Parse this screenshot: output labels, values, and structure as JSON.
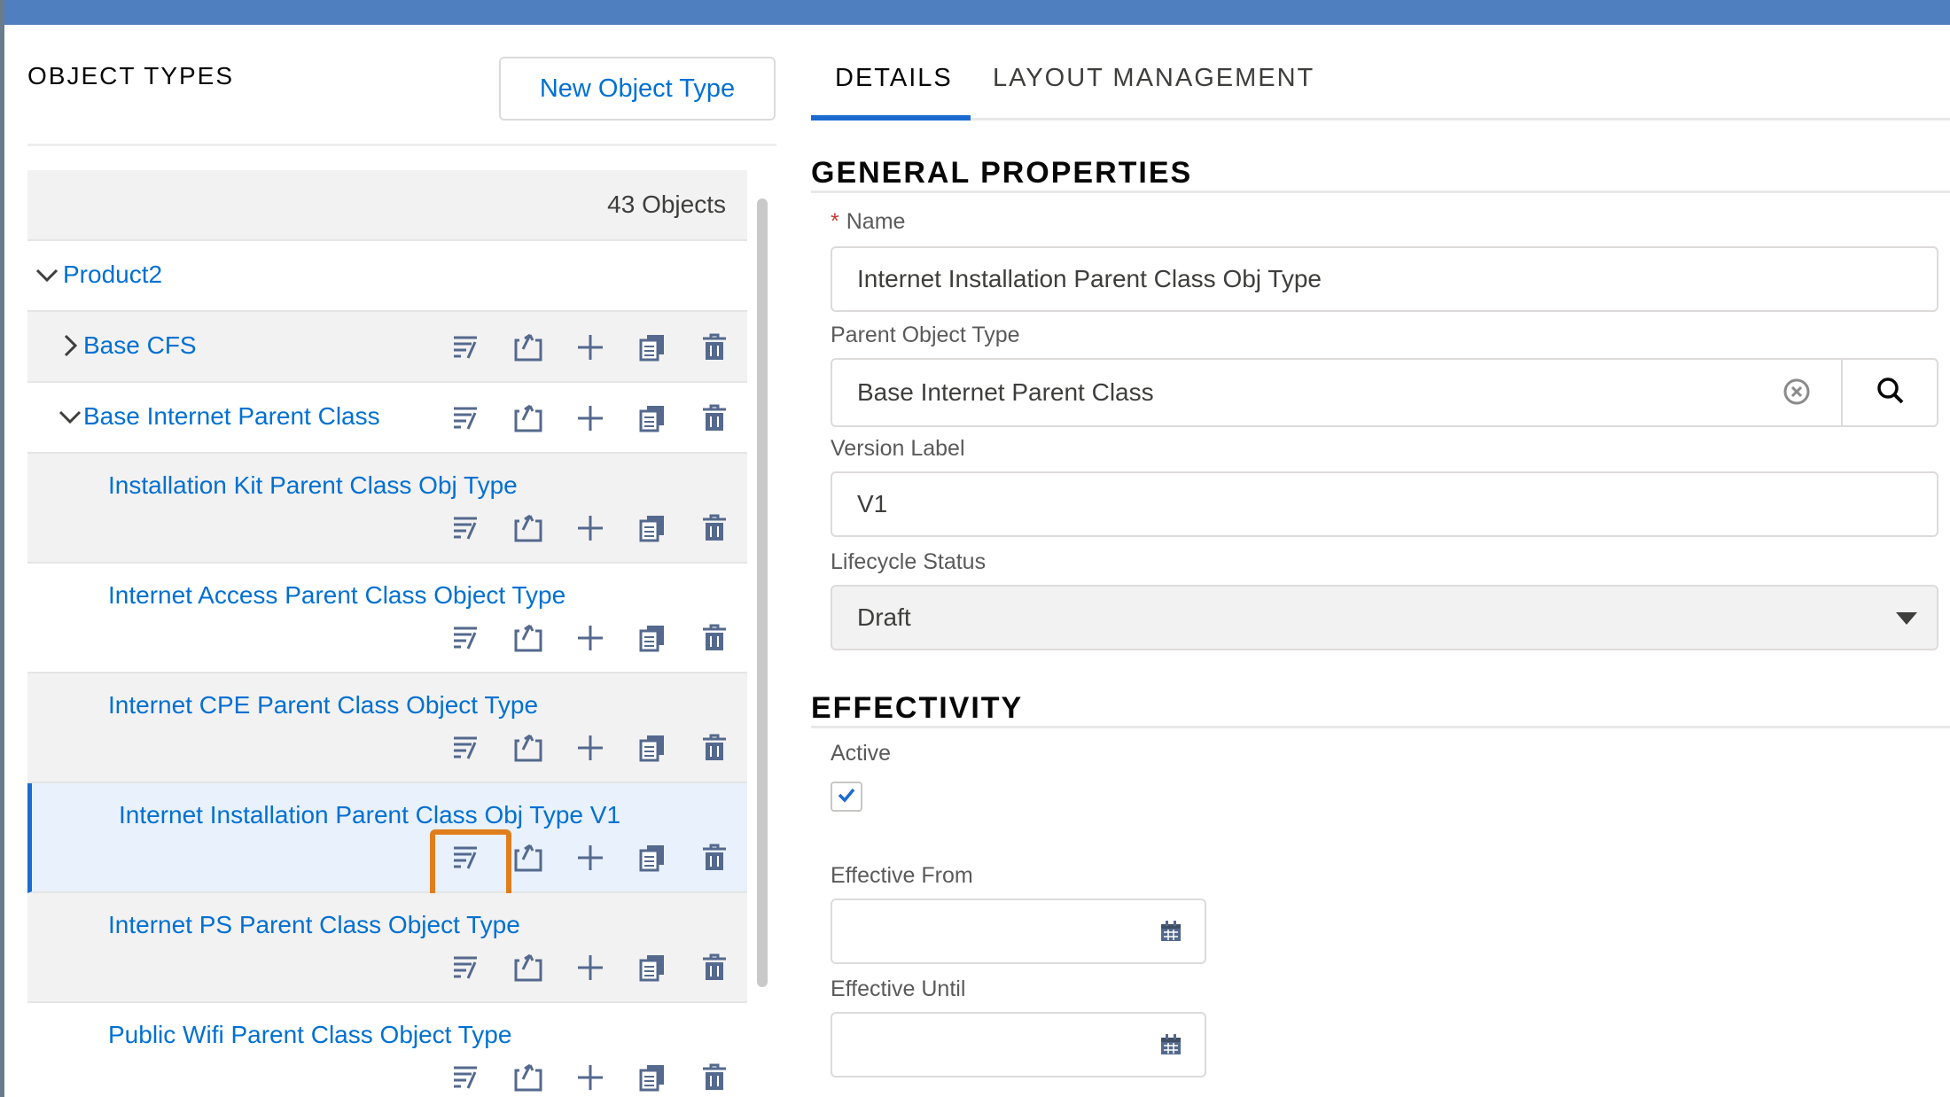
{
  "left": {
    "title": "OBJECT TYPES",
    "new_button": "New Object Type",
    "count": "43 Objects",
    "items": [
      {
        "label": "Product2"
      },
      {
        "label": "Base CFS"
      },
      {
        "label": "Base Internet Parent Class"
      },
      {
        "label": "Installation Kit Parent Class Obj Type"
      },
      {
        "label": "Internet Access Parent Class Object Type"
      },
      {
        "label": "Internet CPE Parent Class Object Type"
      },
      {
        "label": "Internet Installation Parent Class Obj Type V1"
      },
      {
        "label": "Internet PS Parent Class Object Type"
      },
      {
        "label": "Public Wifi Parent Class Object Type"
      }
    ],
    "action_icons": [
      "reorder-icon",
      "move-to-icon",
      "add-icon",
      "copy-icon",
      "delete-icon"
    ],
    "highlight_color": "#e07e1c"
  },
  "right": {
    "tabs": [
      "DETAILS",
      "LAYOUT MANAGEMENT"
    ],
    "general": {
      "title": "GENERAL PROPERTIES",
      "name_label": "Name",
      "name_required": "*",
      "name_value": "Internet Installation Parent Class Obj Type",
      "parent_label": "Parent Object Type",
      "parent_value": "Base Internet Parent Class",
      "version_label": "Version Label",
      "version_value": "V1",
      "lifecycle_label": "Lifecycle Status",
      "lifecycle_value": "Draft"
    },
    "effectivity": {
      "title": "EFFECTIVITY",
      "active_label": "Active",
      "active_checked": true,
      "from_label": "Effective From",
      "from_value": "",
      "until_label": "Effective Until",
      "until_value": ""
    }
  },
  "colors": {
    "link": "#0070d2",
    "accent": "#1b6bd0",
    "topbar": "#4f7fbf"
  }
}
